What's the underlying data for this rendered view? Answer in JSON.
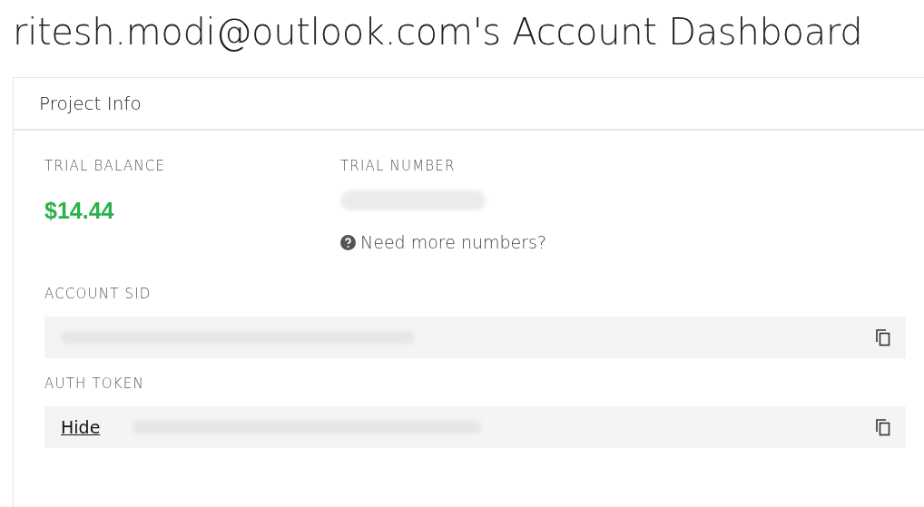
{
  "page_title": "ritesh.modi@outlook.com's Account Dashboard",
  "card": {
    "title": "Project Info",
    "trial_balance": {
      "label": "TRIAL BALANCE",
      "value": "$14.44"
    },
    "trial_number": {
      "label": "TRIAL NUMBER",
      "help_link": "Need more numbers?"
    },
    "account_sid": {
      "label": "ACCOUNT SID"
    },
    "auth_token": {
      "label": "AUTH TOKEN",
      "toggle_link": "Hide"
    }
  }
}
